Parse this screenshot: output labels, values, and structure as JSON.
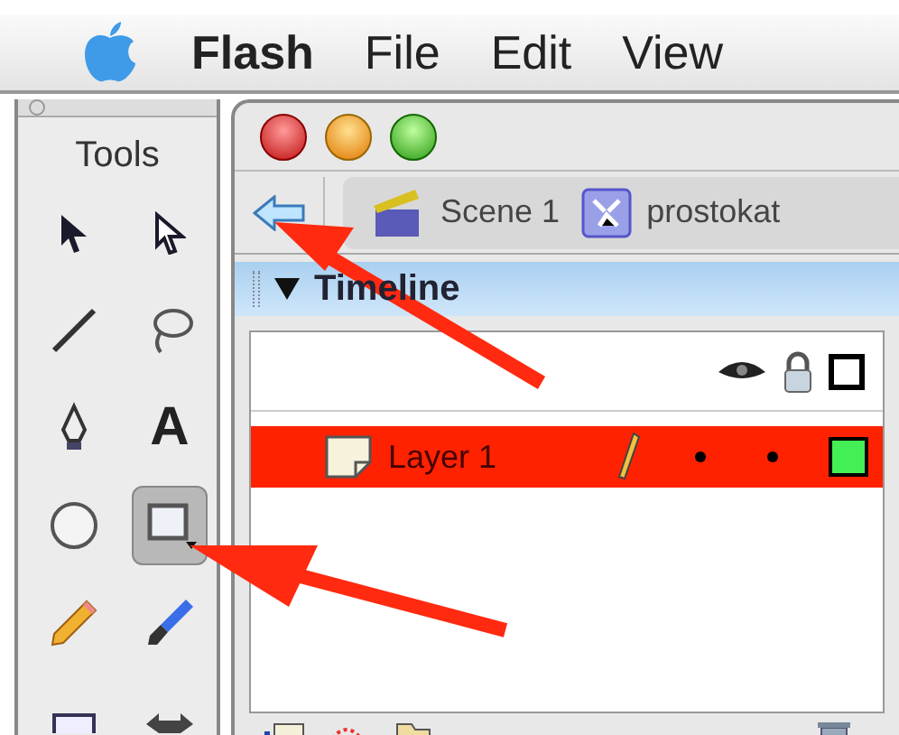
{
  "menu_bar": {
    "items": [
      {
        "label": "Flash",
        "bold": true
      },
      {
        "label": "File",
        "bold": false
      },
      {
        "label": "Edit",
        "bold": false
      },
      {
        "label": "View",
        "bold": false
      }
    ]
  },
  "tools_panel": {
    "title": "Tools",
    "tools": [
      {
        "kind": "arrow",
        "selected": false
      },
      {
        "kind": "subselect",
        "selected": false
      },
      {
        "kind": "line",
        "selected": false
      },
      {
        "kind": "lasso",
        "selected": false
      },
      {
        "kind": "pen",
        "selected": false
      },
      {
        "kind": "text",
        "glyph": "A",
        "selected": false
      },
      {
        "kind": "oval",
        "selected": false
      },
      {
        "kind": "rect",
        "selected": true
      },
      {
        "kind": "pencil",
        "selected": false
      },
      {
        "kind": "brush",
        "selected": false
      },
      {
        "kind": "transform",
        "selected": false
      },
      {
        "kind": "fill",
        "selected": false
      }
    ]
  },
  "edit_bar": {
    "scene": "Scene 1",
    "symbol": "prostokat"
  },
  "timeline": {
    "title": "Timeline",
    "expanded": true,
    "layers": [
      {
        "name": "Layer 1",
        "selected": true,
        "color": "#44ee55"
      }
    ]
  }
}
